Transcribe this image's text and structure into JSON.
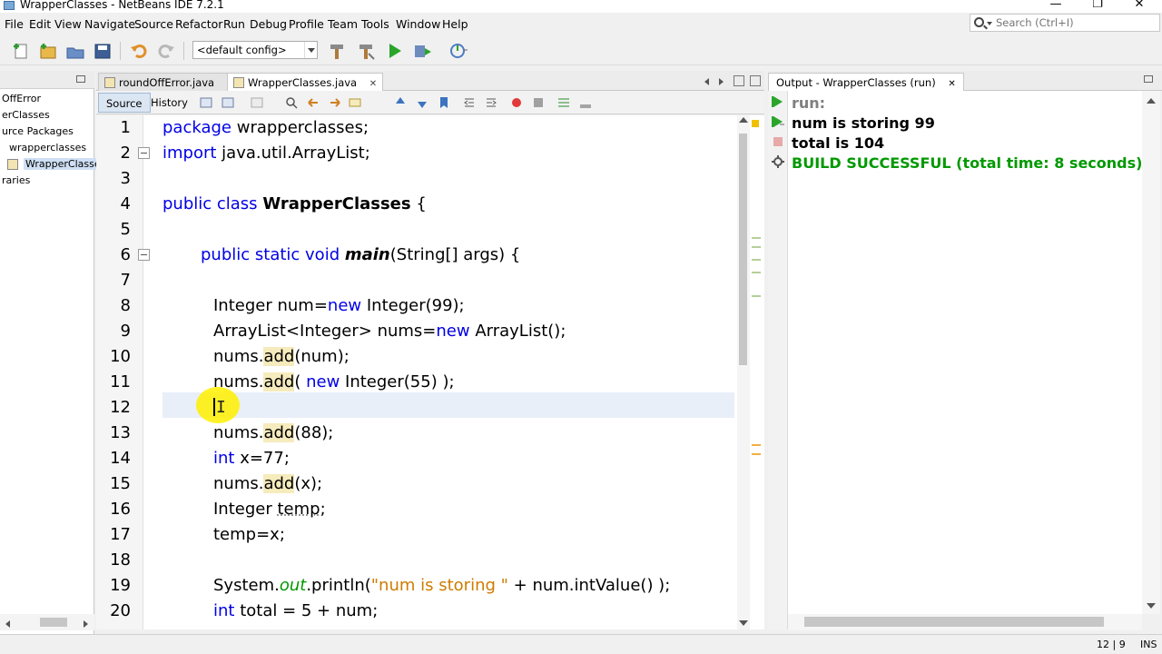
{
  "window": {
    "title": "WrapperClasses - NetBeans IDE 7.2.1",
    "minimize": "—",
    "maximize": "❐",
    "close": "✕"
  },
  "menu": [
    "File",
    "Edit",
    "View",
    "Navigate",
    "Source",
    "Refactor",
    "Run",
    "Debug",
    "Profile",
    "Team",
    "Tools",
    "Window",
    "Help"
  ],
  "search": {
    "placeholder": "Search (Ctrl+I)"
  },
  "toolbar": {
    "config": "<default config>"
  },
  "projects": {
    "items": [
      "OffError",
      "erClasses",
      "urce Packages",
      "wrapperclasses",
      "WrapperClasse",
      "raries"
    ]
  },
  "editor": {
    "tabs": [
      {
        "label": "roundOffError.java",
        "close": "✕"
      },
      {
        "label": "WrapperClasses.java",
        "close": "✕"
      }
    ],
    "source_tab": "Source",
    "history_tab": "History",
    "line_numbers": [
      "1",
      "2",
      "3",
      "4",
      "5",
      "6",
      "7",
      "8",
      "9",
      "10",
      "11",
      "12",
      "13",
      "14",
      "15",
      "16",
      "17",
      "18",
      "19",
      "20"
    ],
    "lines": {
      "l1": {
        "kw": "package",
        "rest": " wrapperclasses;"
      },
      "l2": {
        "kw": "import",
        "rest": " java.util.ArrayList;"
      },
      "l4": {
        "kw": "public class",
        "cls": "WrapperClasses",
        "rest": " {"
      },
      "l6": {
        "kw": "public static void",
        "mth": "main",
        "rest": "(String[] args) {"
      },
      "l8": {
        "a": "Integer num=",
        "kw": "new",
        "b": " Integer(99);"
      },
      "l9": {
        "a": "ArrayList<Integer> nums=",
        "kw": "new",
        "b": " ArrayList();"
      },
      "l10": {
        "a": "nums.",
        "hl": "add",
        "b": "(num);"
      },
      "l11": {
        "a": "nums.",
        "hl": "add",
        "b": "( ",
        "kw": "new",
        "c": " Integer(55) );"
      },
      "l13": {
        "a": "nums.",
        "hl": "add",
        "b": "(88);"
      },
      "l14": {
        "kw": "int",
        "b": " x=77;"
      },
      "l15": {
        "a": "nums.",
        "hl": "add",
        "b": "(x);"
      },
      "l16": {
        "a": "Integer ",
        "und": "temp",
        "b": ";"
      },
      "l17": {
        "a": "temp=x;"
      },
      "l19": {
        "a": "System.",
        "fld": "out",
        "b": ".println(",
        "str": "\"num is storing \"",
        "c": " + num.intValue() );"
      },
      "l20": {
        "kw": "int",
        "b": " total = 5 + num;"
      }
    }
  },
  "output": {
    "title": "Output - WrapperClasses (run)",
    "close": "✕",
    "lines": [
      "run:",
      "num is storing 99",
      "total is 104",
      "BUILD SUCCESSFUL (total time: 8 seconds)"
    ],
    "colors": {
      "run": "#808080",
      "normal": "#000000",
      "success": "#009900"
    }
  },
  "status": {
    "position": "12 | 9",
    "mode": "INS"
  }
}
